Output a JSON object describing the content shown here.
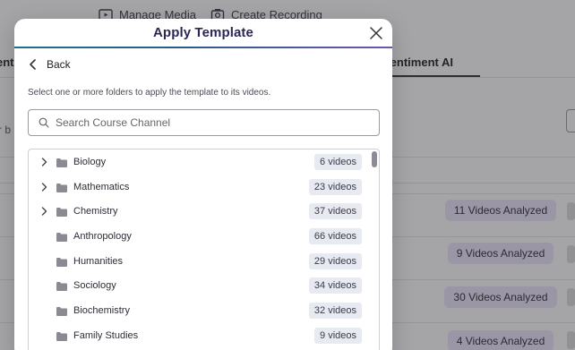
{
  "background": {
    "topbar": {
      "manage_media": "Manage Media",
      "create_recording": "Create Recording"
    },
    "tabs": {
      "left_cut": "ents",
      "sentiment_ai": "Sentiment AI"
    },
    "left_fragment": "r b",
    "analyzed_badges": [
      "11 Videos Analyzed",
      "9 Videos Analyzed",
      "30 Videos Analyzed",
      "4 Videos Analyzed"
    ]
  },
  "modal": {
    "title": "Apply Template",
    "back_label": "Back",
    "instruction": "Select one or more folders to apply the template to its videos.",
    "search": {
      "placeholder": "Search Course Channel",
      "value": ""
    },
    "folders": [
      {
        "name": "Biology",
        "count": "6 videos",
        "expandable": true
      },
      {
        "name": "Mathematics",
        "count": "23 videos",
        "expandable": true
      },
      {
        "name": "Chemistry",
        "count": "37 videos",
        "expandable": true
      },
      {
        "name": "Anthropology",
        "count": "66 videos",
        "expandable": false
      },
      {
        "name": "Humanities",
        "count": "29 videos",
        "expandable": false
      },
      {
        "name": "Sociology",
        "count": "34 videos",
        "expandable": false
      },
      {
        "name": "Biochemistry",
        "count": "32 videos",
        "expandable": false
      },
      {
        "name": "Family Studies",
        "count": "9 videos",
        "expandable": false
      }
    ]
  },
  "colors": {
    "title": "#2a2752",
    "header_rule_start": "#1e6f8a",
    "header_rule_end": "#6b56b3",
    "badge_bg": "#ede6fb",
    "count_bg": "#e8eaf2"
  },
  "icons": [
    "media-icon",
    "recording-icon",
    "close-icon",
    "chevron-left-icon",
    "search-icon",
    "chevron-right-icon",
    "folder-icon"
  ]
}
